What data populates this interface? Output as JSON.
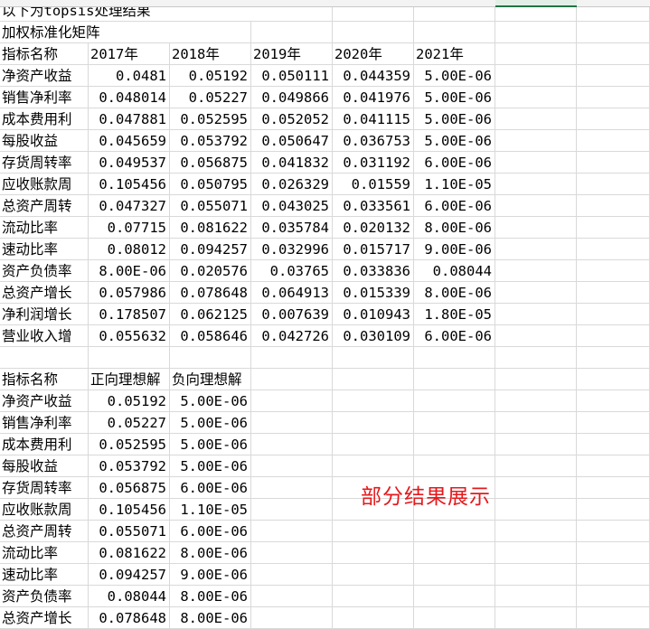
{
  "title_row": "以下为topsis处理结果",
  "subtitle_row": "加权标准化矩阵",
  "matrix_header": [
    "指标名称",
    "2017年",
    "2018年",
    "2019年",
    "2020年",
    "2021年"
  ],
  "matrix_rows": [
    [
      "净资产收益",
      "0.0481",
      "0.05192",
      "0.050111",
      "0.044359",
      "5.00E-06"
    ],
    [
      "销售净利率",
      "0.048014",
      "0.05227",
      "0.049866",
      "0.041976",
      "5.00E-06"
    ],
    [
      "成本费用利",
      "0.047881",
      "0.052595",
      "0.052052",
      "0.041115",
      "5.00E-06"
    ],
    [
      "每股收益",
      "0.045659",
      "0.053792",
      "0.050647",
      "0.036753",
      "5.00E-06"
    ],
    [
      "存货周转率",
      "0.049537",
      "0.056875",
      "0.041832",
      "0.031192",
      "6.00E-06"
    ],
    [
      "应收账款周",
      "0.105456",
      "0.050795",
      "0.026329",
      "0.01559",
      "1.10E-05"
    ],
    [
      "总资产周转",
      "0.047327",
      "0.055071",
      "0.043025",
      "0.033561",
      "6.00E-06"
    ],
    [
      "流动比率",
      "0.07715",
      "0.081622",
      "0.035784",
      "0.020132",
      "8.00E-06"
    ],
    [
      "速动比率",
      "0.08012",
      "0.094257",
      "0.032996",
      "0.015717",
      "9.00E-06"
    ],
    [
      "资产负债率",
      "8.00E-06",
      "0.020576",
      "0.03765",
      "0.033836",
      "0.08044"
    ],
    [
      "总资产增长",
      "0.057986",
      "0.078648",
      "0.064913",
      "0.015339",
      "8.00E-06"
    ],
    [
      "净利润增长",
      "0.178507",
      "0.062125",
      "0.007639",
      "0.010943",
      "1.80E-05"
    ],
    [
      "营业收入增",
      "0.055632",
      "0.058646",
      "0.042726",
      "0.030109",
      "6.00E-06"
    ]
  ],
  "ideal_header": [
    "指标名称",
    "正向理想解",
    "负向理想解"
  ],
  "ideal_rows": [
    [
      "净资产收益",
      "0.05192",
      "5.00E-06"
    ],
    [
      "销售净利率",
      "0.05227",
      "5.00E-06"
    ],
    [
      "成本费用利",
      "0.052595",
      "5.00E-06"
    ],
    [
      "每股收益",
      "0.053792",
      "5.00E-06"
    ],
    [
      "存货周转率",
      "0.056875",
      "6.00E-06"
    ],
    [
      "应收账款周",
      "0.105456",
      "1.10E-05"
    ],
    [
      "总资产周转",
      "0.055071",
      "6.00E-06"
    ],
    [
      "流动比率",
      "0.081622",
      "8.00E-06"
    ],
    [
      "速动比率",
      "0.094257",
      "9.00E-06"
    ],
    [
      "资产负债率",
      "0.08044",
      "8.00E-06"
    ],
    [
      "总资产增长",
      "0.078648",
      "8.00E-06"
    ]
  ],
  "annotation": "部分结果展示",
  "colors": {
    "annotation": "#e5191c",
    "gridline": "#d9d9d9",
    "selected_column": "#217346"
  }
}
